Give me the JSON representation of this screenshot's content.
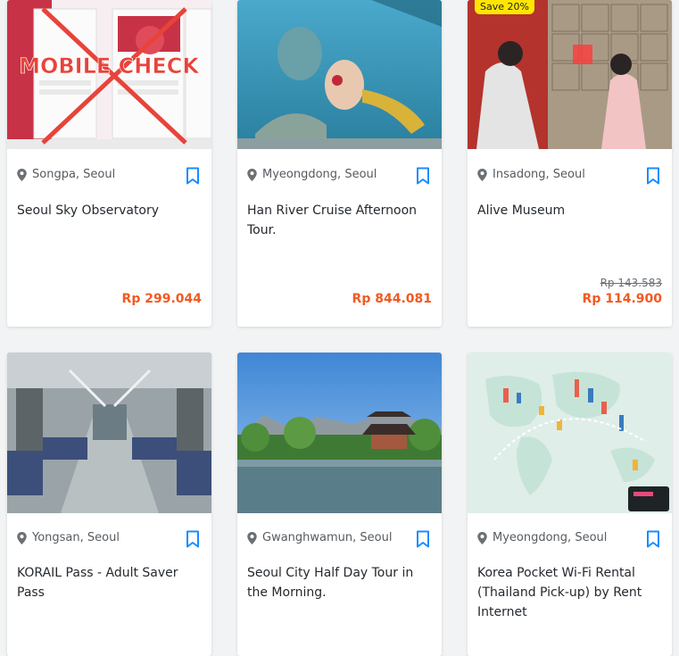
{
  "cards": [
    {
      "location": "Songpa, Seoul",
      "title": "Seoul Sky Observatory",
      "price": "Rp 299.044",
      "overlay_text": "MOBILE CHECK"
    },
    {
      "location": "Myeongdong, Seoul",
      "title": "Han River Cruise Afternoon Tour.",
      "price": "Rp 844.081"
    },
    {
      "location": "Insadong, Seoul",
      "title": "Alive Museum",
      "old_price": "Rp 143.583",
      "price": "Rp 114.900",
      "badge": "Save 20%"
    },
    {
      "location": "Yongsan, Seoul",
      "title": "KORAIL Pass -  Adult Saver Pass"
    },
    {
      "location": "Gwanghwamun, Seoul",
      "title": "Seoul City Half Day Tour in the Morning."
    },
    {
      "location": "Myeongdong, Seoul",
      "title": "Korea Pocket Wi-Fi Rental (Thailand Pick-up) by Rent Internet"
    }
  ],
  "colors": {
    "accent": "#f05a22",
    "bookmark": "#1a8cff",
    "badge": "#ffe600"
  }
}
